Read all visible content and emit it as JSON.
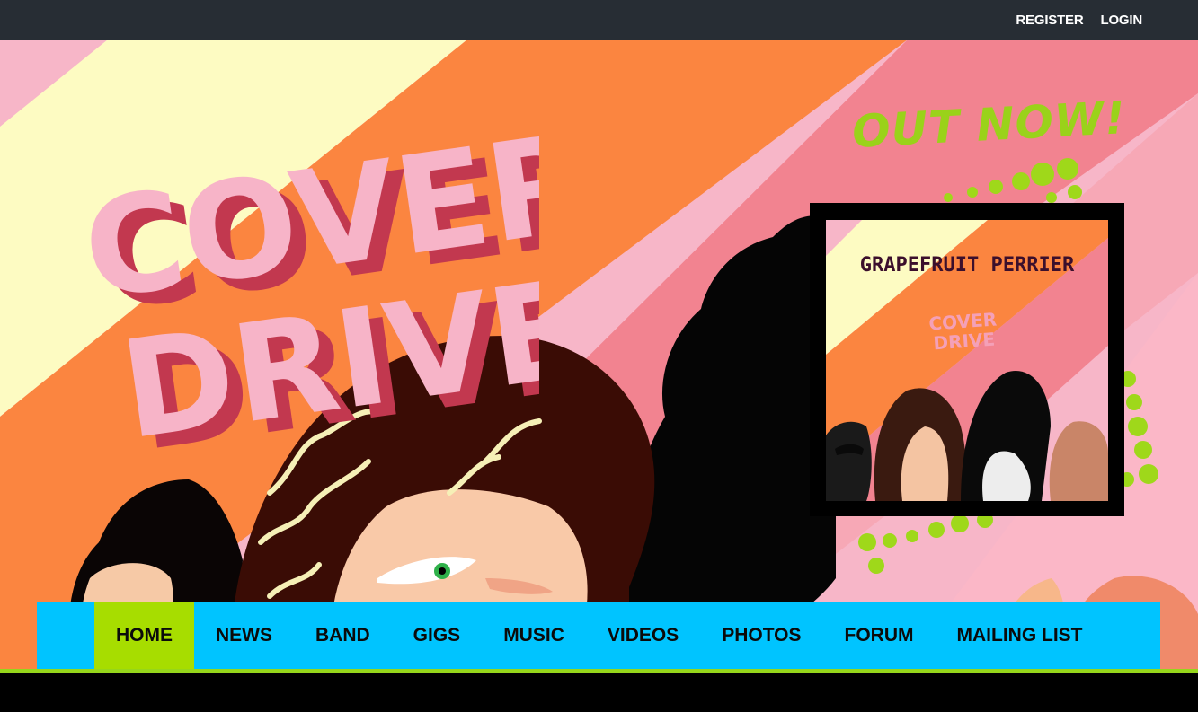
{
  "topbar": {
    "register_label": "REGISTER",
    "login_label": "LOGIN"
  },
  "hero": {
    "logo_line1": "COVER",
    "logo_line2": "DRIVE",
    "promo_text": "OUT NOW!",
    "album": {
      "title": "GRAPEFRUIT PERRIER",
      "logo_line1": "COVER",
      "logo_line2": "DRIVE"
    }
  },
  "nav": {
    "items": [
      {
        "label": "HOME",
        "active": true
      },
      {
        "label": "NEWS"
      },
      {
        "label": "BAND"
      },
      {
        "label": "GIGS"
      },
      {
        "label": "MUSIC"
      },
      {
        "label": "VIDEOS"
      },
      {
        "label": "PHOTOS"
      },
      {
        "label": "FORUM"
      },
      {
        "label": "MAILING LIST"
      }
    ]
  },
  "colors": {
    "topbar_bg": "#272d34",
    "nav_bg": "#00c4ff",
    "nav_active_bg": "#a7dd00",
    "accent_green": "#9ad21a",
    "stripe_pink": "#f7b6c8",
    "stripe_yellow": "#fdfbc2",
    "stripe_orange": "#fb8540",
    "stripe_rose": "#f28390",
    "logo_pink": "#f7b4c8",
    "logo_shadow": "#c2384f"
  }
}
